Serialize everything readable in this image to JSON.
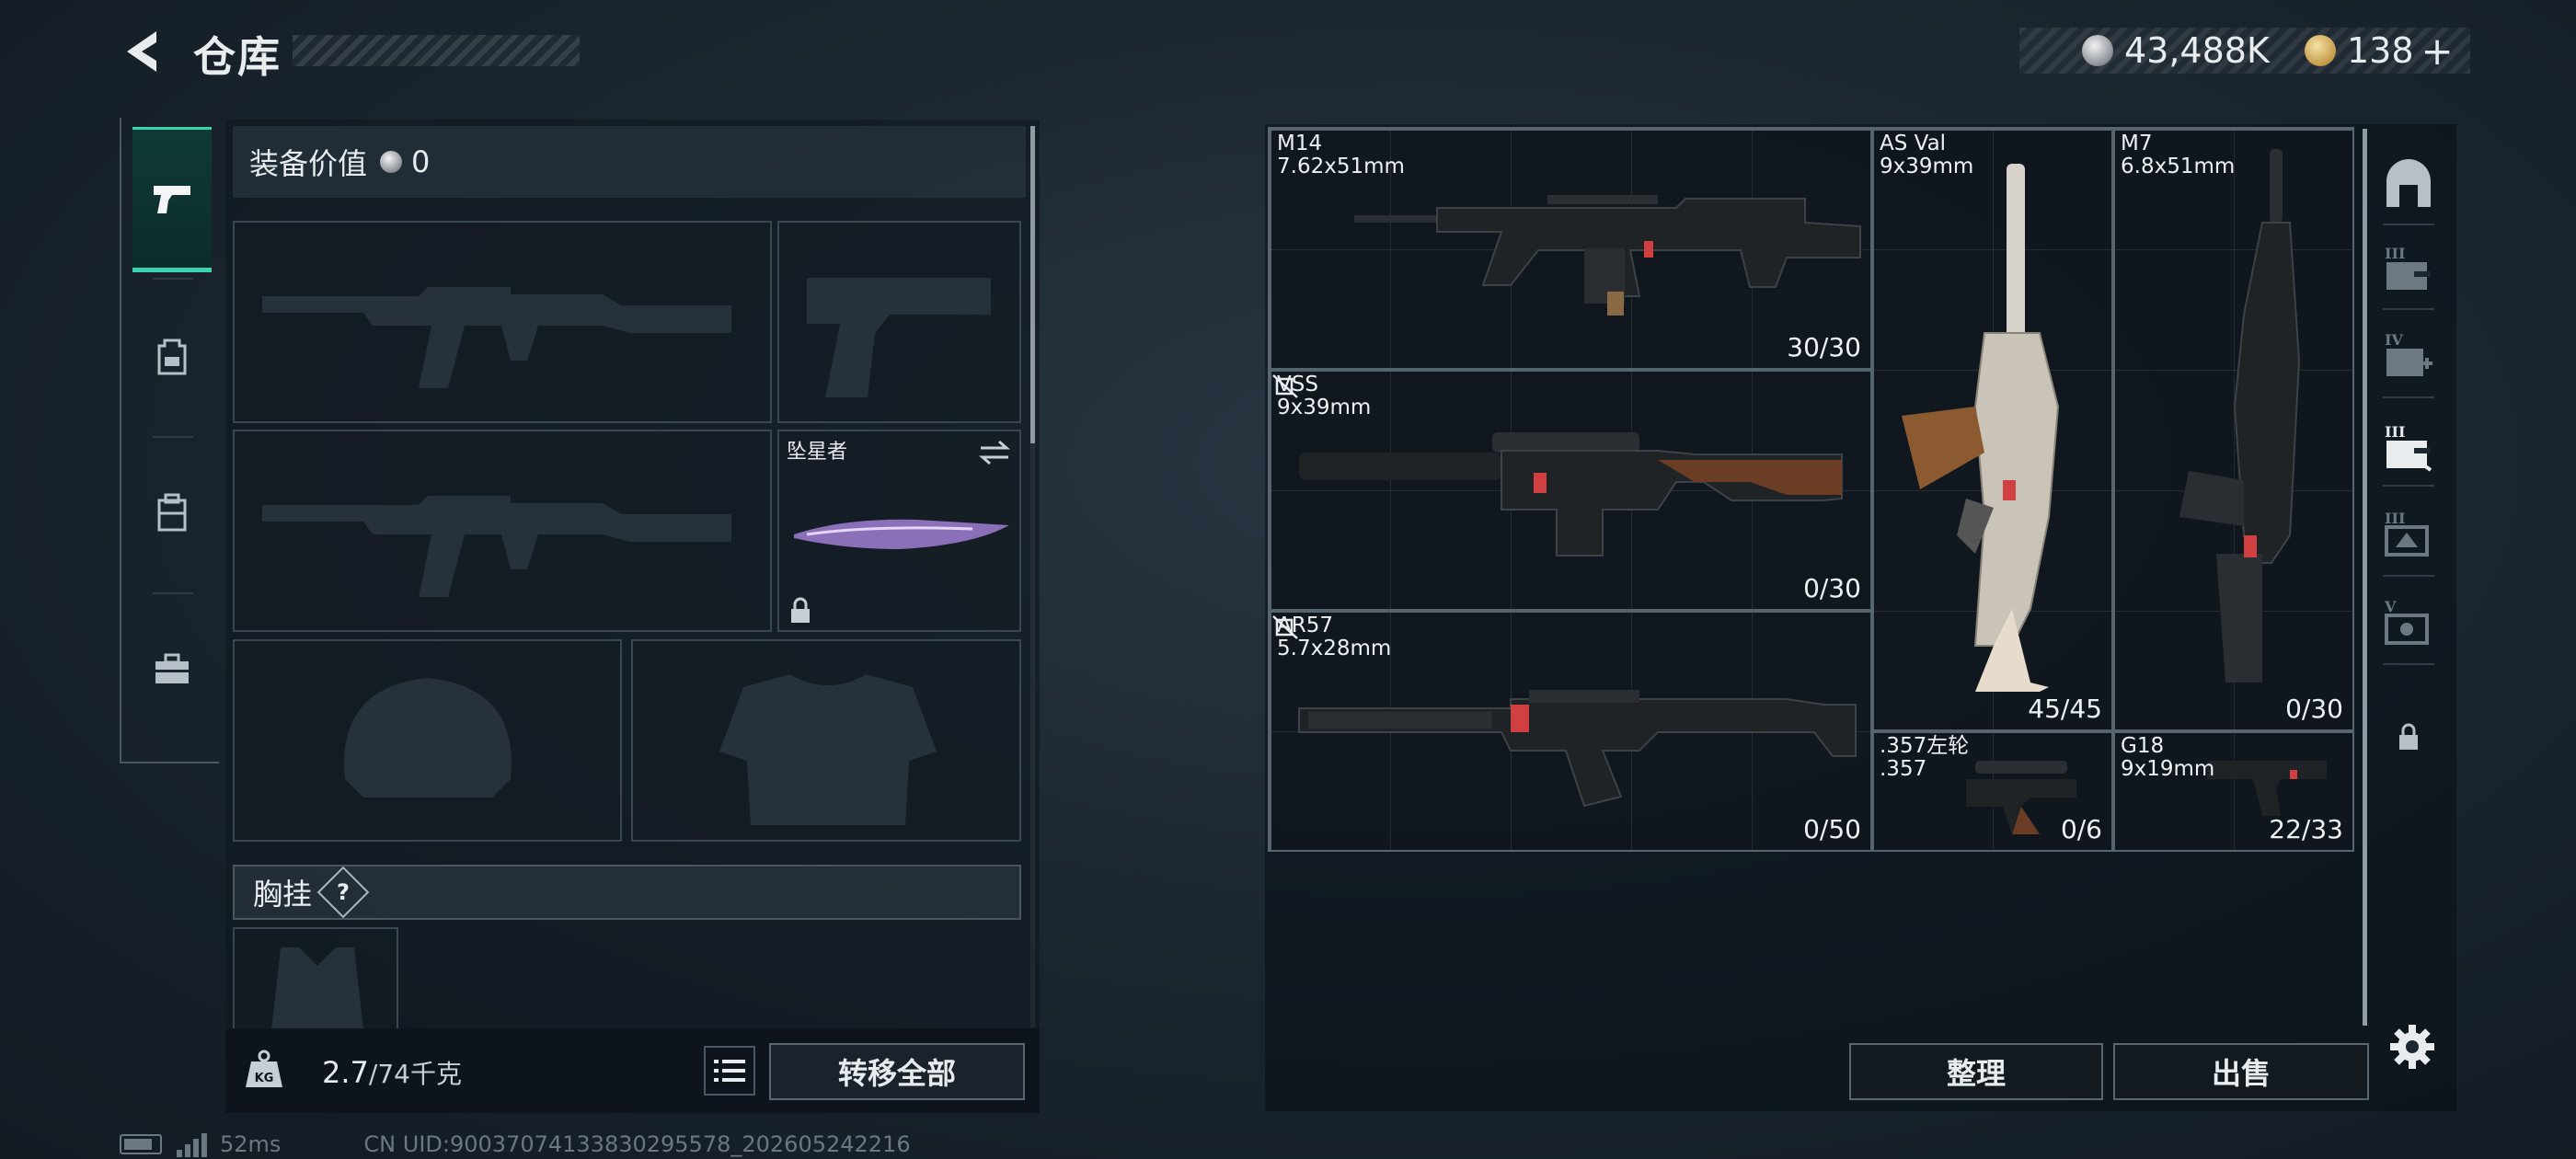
{
  "header": {
    "title": "仓库",
    "currency": {
      "silver": "43,488K",
      "gold": "138",
      "add_label": "+"
    }
  },
  "loadout": {
    "value_label": "装备价值",
    "value": "0",
    "melee_name": "坠星者",
    "vest_label": "胸挂",
    "vest_help": "?",
    "weight": "2.7",
    "weight_max": "/74千克",
    "weight_icon_label": "KG",
    "transfer_label": "转移全部",
    "categories": [
      "pistol-icon",
      "backpack-icon",
      "bag-icon",
      "toolbox-icon"
    ]
  },
  "storage": {
    "weapons": [
      {
        "name": "M14",
        "caliber": "7.62x51mm",
        "ammo": "30/30"
      },
      {
        "name": "VSS",
        "caliber": "9x39mm",
        "ammo": "0/30",
        "flag": "no-insurance-icon"
      },
      {
        "name": "AR57",
        "caliber": "5.7x28mm",
        "ammo": "0/50",
        "flag": "no-insurance-icon"
      },
      {
        "name": "AS Val",
        "caliber": "9x39mm",
        "ammo": "45/45"
      },
      {
        "name": "M7",
        "caliber": "6.8x51mm",
        "ammo": "0/30"
      },
      {
        "name": ".357左轮",
        "caliber": ".357",
        "ammo": "0/6"
      },
      {
        "name": "G18",
        "caliber": "9x19mm",
        "ammo": "22/33"
      }
    ],
    "sort_label": "整理",
    "sell_label": "出售",
    "side_tabs": [
      "safehouse-icon",
      "tier3-medical-icon",
      "tier4-medical-icon",
      "tier3-weapon-crate-icon",
      "tier3-armor-crate-icon",
      "tier5-crate-icon",
      "lock-icon"
    ]
  },
  "status": {
    "ping": "52ms",
    "uid": "CN UID:90037074133830295578_202605242216"
  },
  "colors": {
    "accent": "#3ad2b0",
    "panel": "#121a22",
    "border": "#5a6570"
  }
}
